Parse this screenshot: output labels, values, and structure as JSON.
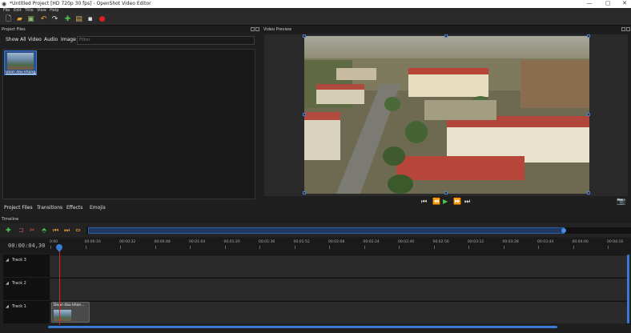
{
  "window": {
    "title": "*Untitled Project [HD 720p 30 fps] - OpenShot Video Editor",
    "controls": [
      "—",
      "▢",
      "✕"
    ]
  },
  "menu": [
    "File",
    "Edit",
    "Title",
    "View",
    "Help"
  ],
  "project_files": {
    "dock_title": "Project Files",
    "tabs": [
      "Show All",
      "Video",
      "Audio",
      "Image"
    ],
    "filter_placeholder": "Filter",
    "file_name": "Doan dau khong..."
  },
  "bottom_tabs": [
    "Project Files",
    "Transitions",
    "Effects",
    "Emojis"
  ],
  "video_preview": {
    "dock_title": "Video Preview"
  },
  "playback": [
    "⏮",
    "⏪",
    "▶",
    "⏩",
    "⏭"
  ],
  "timeline": {
    "dock_title": "Timeline",
    "timecode": "00:00:04,30",
    "ticks": [
      "0:00",
      "00:00:16",
      "00:00:32",
      "00:00:48",
      "00:01:04",
      "00:01:20",
      "00:01:36",
      "00:01:52",
      "00:02:08",
      "00:02:24",
      "00:02:40",
      "00:02:56",
      "00:03:12",
      "00:03:28",
      "00:03:44",
      "00:04:00",
      "00:04:16"
    ],
    "tracks": [
      "Track 3",
      "Track 2",
      "Track 1"
    ],
    "clip_title": "Doan dau khon..."
  },
  "colors": {
    "accent": "#3a7bd5",
    "playhead": "#dd2222",
    "background": "#1f1f1f"
  }
}
